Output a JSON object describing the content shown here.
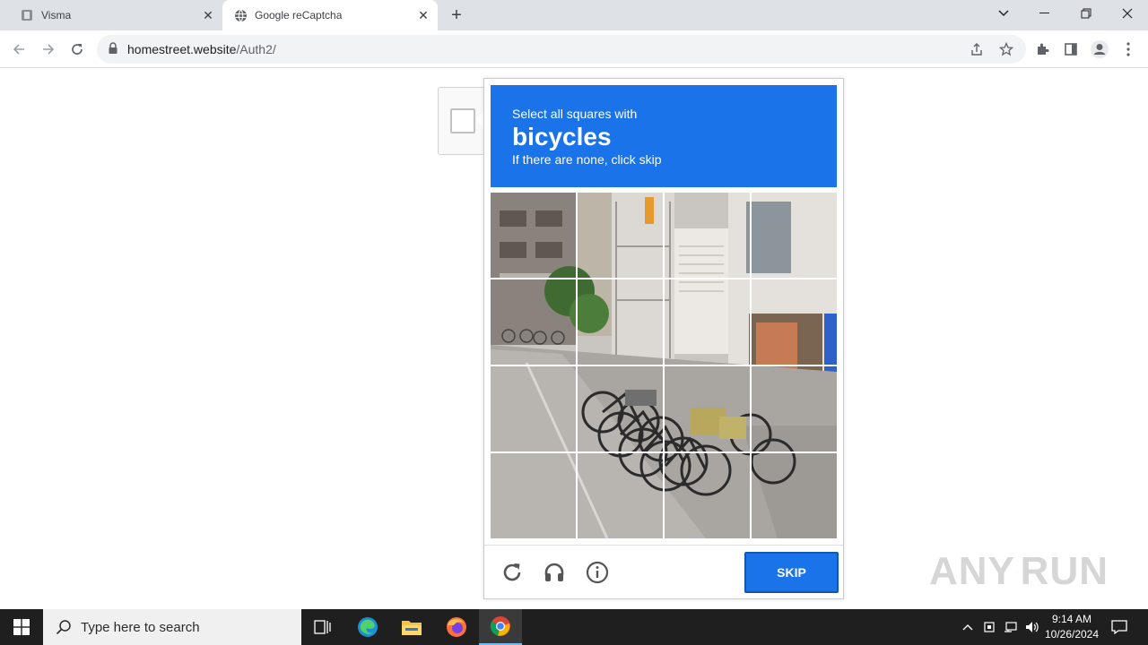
{
  "browser": {
    "tabs": [
      {
        "title": "Visma",
        "active": false
      },
      {
        "title": "Google reCaptcha",
        "active": true
      }
    ],
    "address": {
      "host": "homestreet.website",
      "path": "/Auth2/"
    }
  },
  "captcha": {
    "instruction_line1": "Select all squares with",
    "target": "bicycles",
    "instruction_line3": "If there are none, click skip",
    "grid": {
      "rows": 4,
      "cols": 4
    },
    "skip_label": "SKIP",
    "accent_color": "#1a73e8"
  },
  "watermark": {
    "left": "ANY",
    "right": "RUN"
  },
  "taskbar": {
    "search_placeholder": "Type here to search",
    "time": "9:14 AM",
    "date": "10/26/2024"
  },
  "icons": [
    "back-icon",
    "forward-icon",
    "reload-icon",
    "lock-icon",
    "share-icon",
    "star-icon",
    "extensions-icon",
    "side-panel-icon",
    "profile-icon",
    "menu-icon",
    "audio-icon",
    "info-icon",
    "windows-start-icon",
    "search-icon"
  ]
}
